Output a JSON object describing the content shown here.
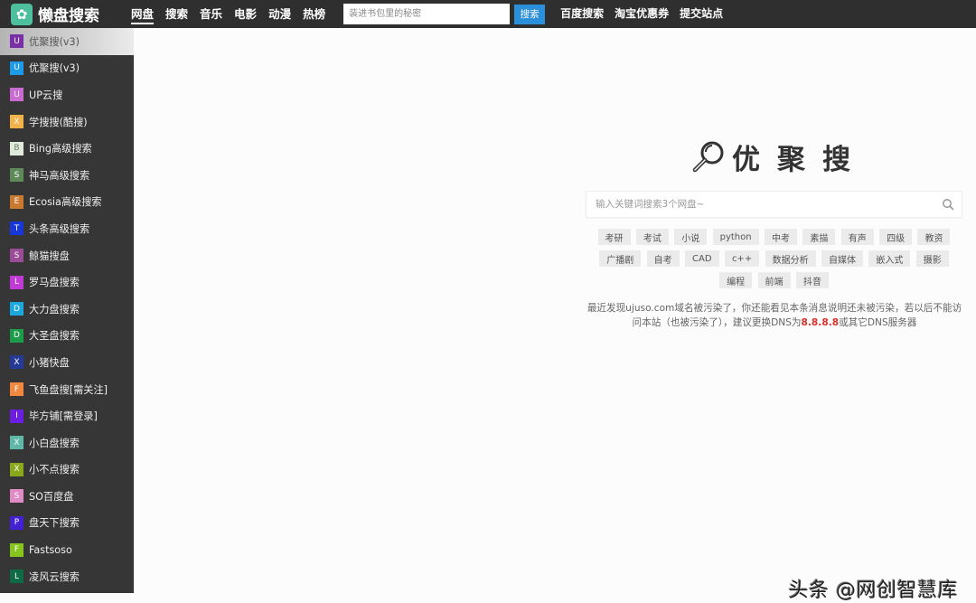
{
  "app": {
    "logo_icon": "gear-icon",
    "logo_text": "懒盘搜索"
  },
  "topnav": {
    "items": [
      {
        "label": "网盘",
        "active": true
      },
      {
        "label": "搜索",
        "active": false
      },
      {
        "label": "音乐",
        "active": false
      },
      {
        "label": "电影",
        "active": false
      },
      {
        "label": "动漫",
        "active": false
      },
      {
        "label": "热榜",
        "active": false
      }
    ],
    "search_placeholder": "装进书包里的秘密",
    "search_value": "",
    "search_button": "搜索",
    "right_items": [
      "百度搜索",
      "淘宝优惠券",
      "提交站点"
    ]
  },
  "sidebar": {
    "items": [
      {
        "badge": "U",
        "color": "#7b2fa6",
        "label": "优聚搜(v3)",
        "active": true
      },
      {
        "badge": "U",
        "color": "#1e9be8",
        "label": "优聚搜(v3)",
        "active": false
      },
      {
        "badge": "U",
        "color": "#c96bd0",
        "label": "UP云搜",
        "active": false
      },
      {
        "badge": "X",
        "color": "#f2b24a",
        "label": "学搜搜(酷搜)",
        "active": false
      },
      {
        "badge": "B",
        "color": "#dfeadb",
        "label": "Bing高级搜索",
        "active": false,
        "badge_text_color": "#6a7a66"
      },
      {
        "badge": "S",
        "color": "#5e8a5a",
        "label": "神马高级搜索",
        "active": false
      },
      {
        "badge": "E",
        "color": "#c97a2e",
        "label": "Ecosia高级搜索",
        "active": false
      },
      {
        "badge": "T",
        "color": "#1737d8",
        "label": "头条高级搜索",
        "active": false
      },
      {
        "badge": "S",
        "color": "#9a4c96",
        "label": "鲸猫搜盘",
        "active": false
      },
      {
        "badge": "L",
        "color": "#c23ad6",
        "label": "罗马盘搜索",
        "active": false
      },
      {
        "badge": "D",
        "color": "#1ba8df",
        "label": "大力盘搜索",
        "active": false
      },
      {
        "badge": "D",
        "color": "#1c9c4a",
        "label": "大圣盘搜索",
        "active": false
      },
      {
        "badge": "X",
        "color": "#243a96",
        "label": "小猪快盘",
        "active": false
      },
      {
        "badge": "F",
        "color": "#f0883f",
        "label": "飞鱼盘搜[需关注]",
        "active": false
      },
      {
        "badge": "I",
        "color": "#6b1ee0",
        "label": "毕方铺[需登录]",
        "active": false
      },
      {
        "badge": "X",
        "color": "#5fb7a8",
        "label": "小白盘搜索",
        "active": false
      },
      {
        "badge": "X",
        "color": "#8aa81c",
        "label": "小不点搜索",
        "active": false
      },
      {
        "badge": "S",
        "color": "#e08bc6",
        "label": "SO百度盘",
        "active": false
      },
      {
        "badge": "P",
        "color": "#4420d4",
        "label": "盘天下搜索",
        "active": false
      },
      {
        "badge": "F",
        "color": "#86c41e",
        "label": "Fastsoso",
        "active": false
      },
      {
        "badge": "L",
        "color": "#0f6b45",
        "label": "凌风云搜索",
        "active": false
      }
    ]
  },
  "main": {
    "brand_icon": "magnifier-icon",
    "brand_title": "优聚搜",
    "search_placeholder": "输入关键词搜索3个网盘~",
    "search_value": "",
    "tags": [
      "考研",
      "考试",
      "小说",
      "python",
      "中考",
      "素描",
      "有声",
      "四级",
      "教资",
      "广播剧",
      "自考",
      "CAD",
      "c++",
      "数据分析",
      "自媒体",
      "嵌入式",
      "摄影",
      "编程",
      "前端",
      "抖音"
    ],
    "notice": {
      "prefix": "最近发现ujuso.com域名被污染了，你还能看见本条消息说明还未被污染，若以后不能访问本站（也被污染了），建议更换DNS为",
      "dns": "8.8.8.8",
      "suffix": "或其它DNS服务器",
      "dns_color": "#d9312b"
    }
  },
  "watermark": "头条 @网创智慧库"
}
